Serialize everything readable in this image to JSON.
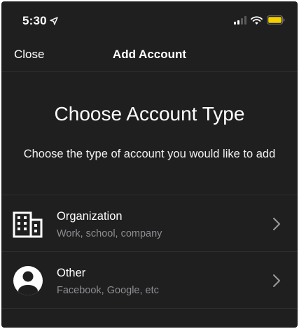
{
  "status_bar": {
    "time": "5:30",
    "icons": [
      "location-arrow-icon",
      "cellular-signal-icon",
      "wifi-icon",
      "battery-icon"
    ],
    "battery_color": "#f5d000"
  },
  "nav": {
    "close_label": "Close",
    "title": "Add Account"
  },
  "main": {
    "heading": "Choose Account Type",
    "subheading": "Choose the type of account you would like to add"
  },
  "account_types": [
    {
      "title": "Organization",
      "subtitle": "Work, school, company",
      "icon": "building-icon"
    },
    {
      "title": "Other",
      "subtitle": "Facebook, Google, etc",
      "icon": "person-circle-icon"
    }
  ],
  "colors": {
    "background": "#1f1f1f",
    "text_primary": "#ffffff",
    "text_secondary": "#8e8e93",
    "separator": "#2e2e2e"
  }
}
